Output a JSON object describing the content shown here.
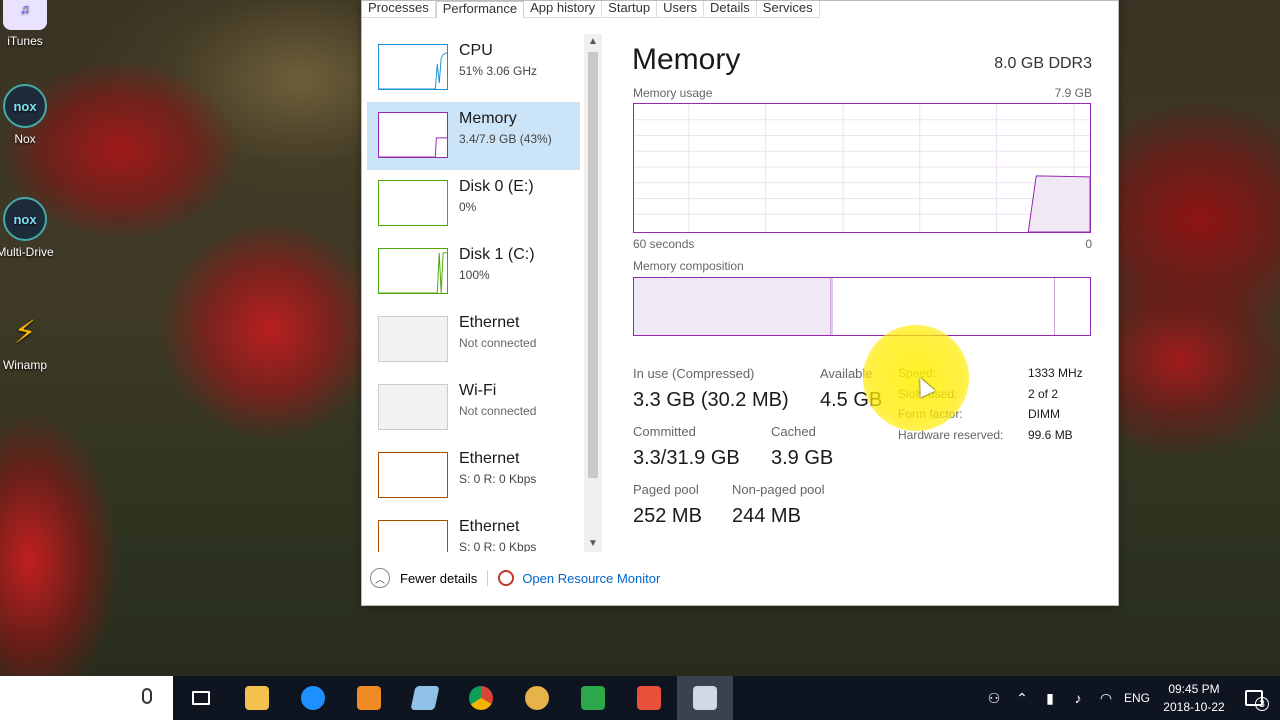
{
  "desktop_icons": [
    {
      "label": "iTunes",
      "icon": "itunes-icon"
    },
    {
      "label": "Nox",
      "icon": "nox-icon"
    },
    {
      "label": "Multi-Drive",
      "icon": "nox-multidrive-icon"
    },
    {
      "label": "Winamp",
      "icon": "winamp-icon"
    }
  ],
  "tabs": [
    "Processes",
    "Performance",
    "App history",
    "Startup",
    "Users",
    "Details",
    "Services"
  ],
  "active_tab": "Performance",
  "sidebar": [
    {
      "name": "CPU",
      "sub": "51% 3.06 GHz",
      "color": "#1f8fd6"
    },
    {
      "name": "Memory",
      "sub": "3.4/7.9 GB (43%)",
      "color": "#9528b4"
    },
    {
      "name": "Disk 0 (E:)",
      "sub": "0%",
      "color": "#4da60c"
    },
    {
      "name": "Disk 1 (C:)",
      "sub": "100%",
      "color": "#4da60c"
    },
    {
      "name": "Ethernet",
      "sub": "Not connected",
      "color": "#999999"
    },
    {
      "name": "Wi-Fi",
      "sub": "Not connected",
      "color": "#999999"
    },
    {
      "name": "Ethernet",
      "sub": "S: 0 R: 0 Kbps",
      "color": "#a74f01"
    },
    {
      "name": "Ethernet",
      "sub": "S: 0 R: 0 Kbps",
      "color": "#a74f01"
    }
  ],
  "memory": {
    "title": "Memory",
    "spec": "8.0 GB DDR3",
    "usage_label": "Memory usage",
    "usage_max": "7.9 GB",
    "time_left": "60 seconds",
    "time_right": "0",
    "composition_label": "Memory composition",
    "in_use_label": "In use (Compressed)",
    "in_use_value": "3.3 GB (30.2 MB)",
    "available_label": "Available",
    "available_value": "4.5 GB",
    "committed_label": "Committed",
    "committed_value": "3.3/31.9 GB",
    "cached_label": "Cached",
    "cached_value": "3.9 GB",
    "paged_label": "Paged pool",
    "paged_value": "252 MB",
    "nonpaged_label": "Non-paged pool",
    "nonpaged_value": "244 MB",
    "specs": [
      {
        "k": "Speed:",
        "v": "1333 MHz"
      },
      {
        "k": "Slots used:",
        "v": "2 of 2"
      },
      {
        "k": "Form factor:",
        "v": "DIMM"
      },
      {
        "k": "Hardware reserved:",
        "v": "99.6 MB"
      }
    ]
  },
  "footer": {
    "fewer": "Fewer details",
    "resmon": "Open Resource Monitor"
  },
  "taskbar": {
    "lang": "ENG",
    "time": "09:45 PM",
    "date": "2018-10-22",
    "notifications": "3"
  }
}
